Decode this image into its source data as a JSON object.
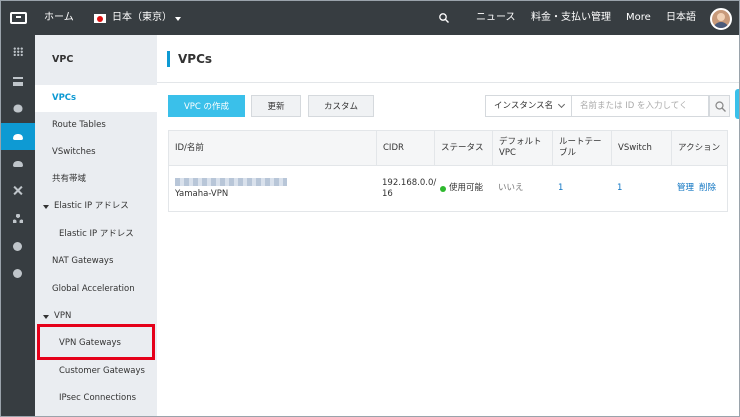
{
  "topbar": {
    "home": "ホーム",
    "region": "日本（東京）",
    "news": "ニュース",
    "billing": "料金・支払い管理",
    "more": "More",
    "language": "日本語"
  },
  "sidebar": {
    "title": "VPC",
    "items": [
      {
        "label": "VPCs"
      },
      {
        "label": "Route Tables"
      },
      {
        "label": "VSwitches"
      },
      {
        "label": "共有帯域"
      },
      {
        "label": "Elastic IP アドレス"
      },
      {
        "label": "Elastic IP アドレス"
      },
      {
        "label": "NAT Gateways"
      },
      {
        "label": "Global Acceleration"
      },
      {
        "label": "VPN"
      },
      {
        "label": "VPN Gateways"
      },
      {
        "label": "Customer Gateways"
      },
      {
        "label": "IPsec Connections"
      }
    ]
  },
  "main": {
    "title": "VPCs",
    "buttons": {
      "create": "VPC の作成",
      "refresh": "更新",
      "custom": "カスタム"
    },
    "search": {
      "filter": "インスタンス名",
      "placeholder": "名前または ID を入力してく"
    },
    "table": {
      "headers": [
        "ID/名前",
        "CIDR",
        "ステータス",
        "デフォルト\nVPC",
        "ルートテー\nブル",
        "VSwitch",
        "アクション"
      ],
      "rows": [
        {
          "name": "Yamaha-VPN",
          "cidr": "192.168.0.0/\n16",
          "status": "使用可能",
          "default_vpc": "いいえ",
          "route_tables": "1",
          "vswitch": "1",
          "action_manage": "管理",
          "action_delete": "削除"
        }
      ]
    }
  },
  "colors": {
    "accent": "#0e9ad3",
    "primary_button": "#3ac0ea",
    "highlight_box": "#e5001a",
    "topbar": "#373d41"
  }
}
